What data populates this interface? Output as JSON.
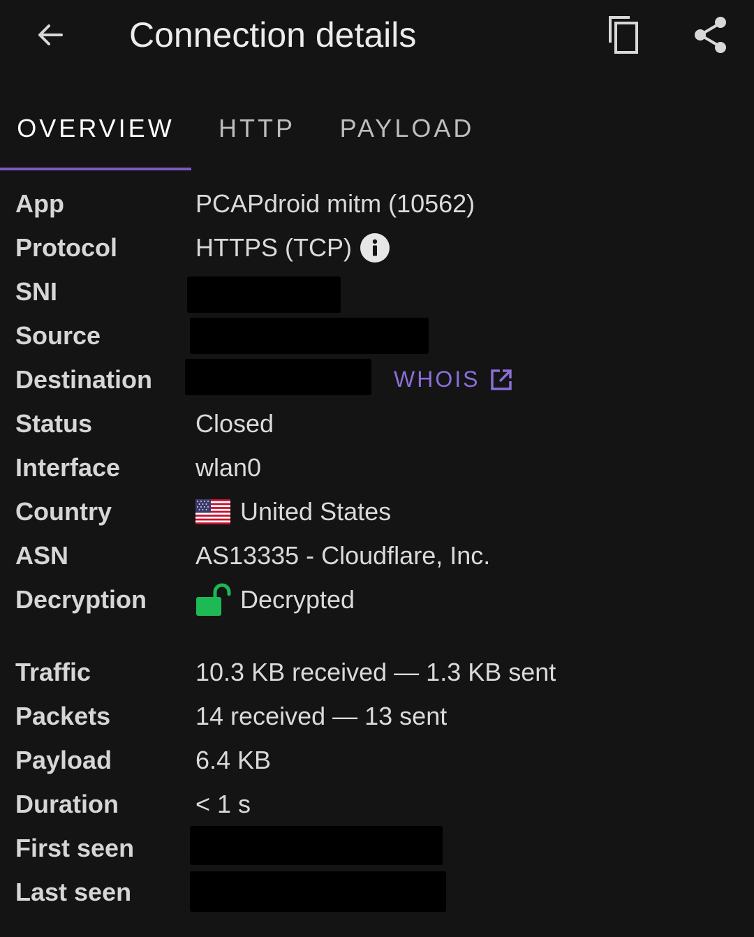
{
  "appbar": {
    "title": "Connection details",
    "icons": {
      "back": "arrow-left-icon",
      "copy": "copy-icon",
      "share": "share-icon"
    }
  },
  "tabs": [
    {
      "label": "OVERVIEW",
      "active": true
    },
    {
      "label": "HTTP",
      "active": false
    },
    {
      "label": "PAYLOAD",
      "active": false
    }
  ],
  "colors": {
    "background": "#141414",
    "accent": "#7e57c2",
    "link": "#8c6ed8",
    "decrypted_green": "#1db954"
  },
  "details": {
    "app": {
      "label": "App",
      "value": "PCAPdroid mitm (10562)"
    },
    "protocol": {
      "label": "Protocol",
      "value": "HTTPS (TCP)"
    },
    "sni": {
      "label": "SNI",
      "value": ""
    },
    "source": {
      "label": "Source",
      "value": ""
    },
    "destination": {
      "label": "Destination",
      "value": "",
      "link": "WHOIS"
    },
    "status": {
      "label": "Status",
      "value": "Closed"
    },
    "interface": {
      "label": "Interface",
      "value": "wlan0"
    },
    "country": {
      "label": "Country",
      "value": "United States",
      "icon": "us-flag-icon"
    },
    "asn": {
      "label": "ASN",
      "value": "AS13335 - Cloudflare, Inc."
    },
    "decryption": {
      "label": "Decryption",
      "value": "Decrypted",
      "icon": "unlocked-padlock-icon"
    },
    "traffic": {
      "label": "Traffic",
      "value": "10.3 KB received — 1.3 KB sent"
    },
    "packets": {
      "label": "Packets",
      "value": "14 received — 13 sent"
    },
    "payload": {
      "label": "Payload",
      "value": "6.4 KB"
    },
    "duration": {
      "label": "Duration",
      "value": "< 1 s"
    },
    "first_seen": {
      "label": "First seen",
      "value": ""
    },
    "last_seen": {
      "label": "Last seen",
      "value": ""
    }
  }
}
